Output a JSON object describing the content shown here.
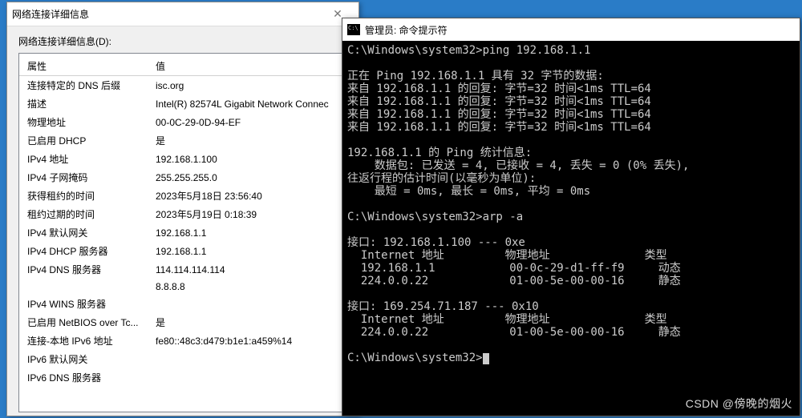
{
  "dialog": {
    "title": "网络连接详细信息",
    "subtitle": "网络连接详细信息(D):",
    "columns": {
      "property": "属性",
      "value": "值"
    },
    "rows": [
      {
        "p": "连接特定的 DNS 后缀",
        "v": "isc.org"
      },
      {
        "p": "描述",
        "v": "Intel(R) 82574L Gigabit Network Connec"
      },
      {
        "p": "物理地址",
        "v": "00-0C-29-0D-94-EF"
      },
      {
        "p": "已启用 DHCP",
        "v": "是"
      },
      {
        "p": "IPv4 地址",
        "v": "192.168.1.100"
      },
      {
        "p": "IPv4 子网掩码",
        "v": "255.255.255.0"
      },
      {
        "p": "获得租约的时间",
        "v": "2023年5月18日 23:56:40"
      },
      {
        "p": "租约过期的时间",
        "v": "2023年5月19日 0:18:39"
      },
      {
        "p": "IPv4 默认网关",
        "v": "192.168.1.1"
      },
      {
        "p": "IPv4 DHCP 服务器",
        "v": "192.168.1.1"
      },
      {
        "p": "IPv4 DNS 服务器",
        "v": "114.114.114.114"
      },
      {
        "p": "",
        "v": "8.8.8.8"
      },
      {
        "p": "IPv4 WINS 服务器",
        "v": ""
      },
      {
        "p": "已启用 NetBIOS over Tc...",
        "v": "是"
      },
      {
        "p": "连接-本地 IPv6 地址",
        "v": "fe80::48c3:d479:b1e1:a459%14"
      },
      {
        "p": "IPv6 默认网关",
        "v": ""
      },
      {
        "p": "IPv6 DNS 服务器",
        "v": ""
      }
    ]
  },
  "cmd": {
    "title": "管理员: 命令提示符",
    "lines": [
      "C:\\Windows\\system32>ping 192.168.1.1",
      "",
      "正在 Ping 192.168.1.1 具有 32 字节的数据:",
      "来自 192.168.1.1 的回复: 字节=32 时间<1ms TTL=64",
      "来自 192.168.1.1 的回复: 字节=32 时间<1ms TTL=64",
      "来自 192.168.1.1 的回复: 字节=32 时间<1ms TTL=64",
      "来自 192.168.1.1 的回复: 字节=32 时间<1ms TTL=64",
      "",
      "192.168.1.1 的 Ping 统计信息:",
      "    数据包: 已发送 = 4, 已接收 = 4, 丢失 = 0 (0% 丢失),",
      "往返行程的估计时间(以毫秒为单位):",
      "    最短 = 0ms, 最长 = 0ms, 平均 = 0ms",
      "",
      "C:\\Windows\\system32>arp -a",
      "",
      "接口: 192.168.1.100 --- 0xe",
      "  Internet 地址         物理地址              类型",
      "  192.168.1.1           00-0c-29-d1-ff-f9     动态",
      "  224.0.0.22            01-00-5e-00-00-16     静态",
      "",
      "接口: 169.254.71.187 --- 0x10",
      "  Internet 地址         物理地址              类型",
      "  224.0.0.22            01-00-5e-00-00-16     静态",
      "",
      "C:\\Windows\\system32>"
    ]
  },
  "watermark": "CSDN @傍晚的烟火"
}
